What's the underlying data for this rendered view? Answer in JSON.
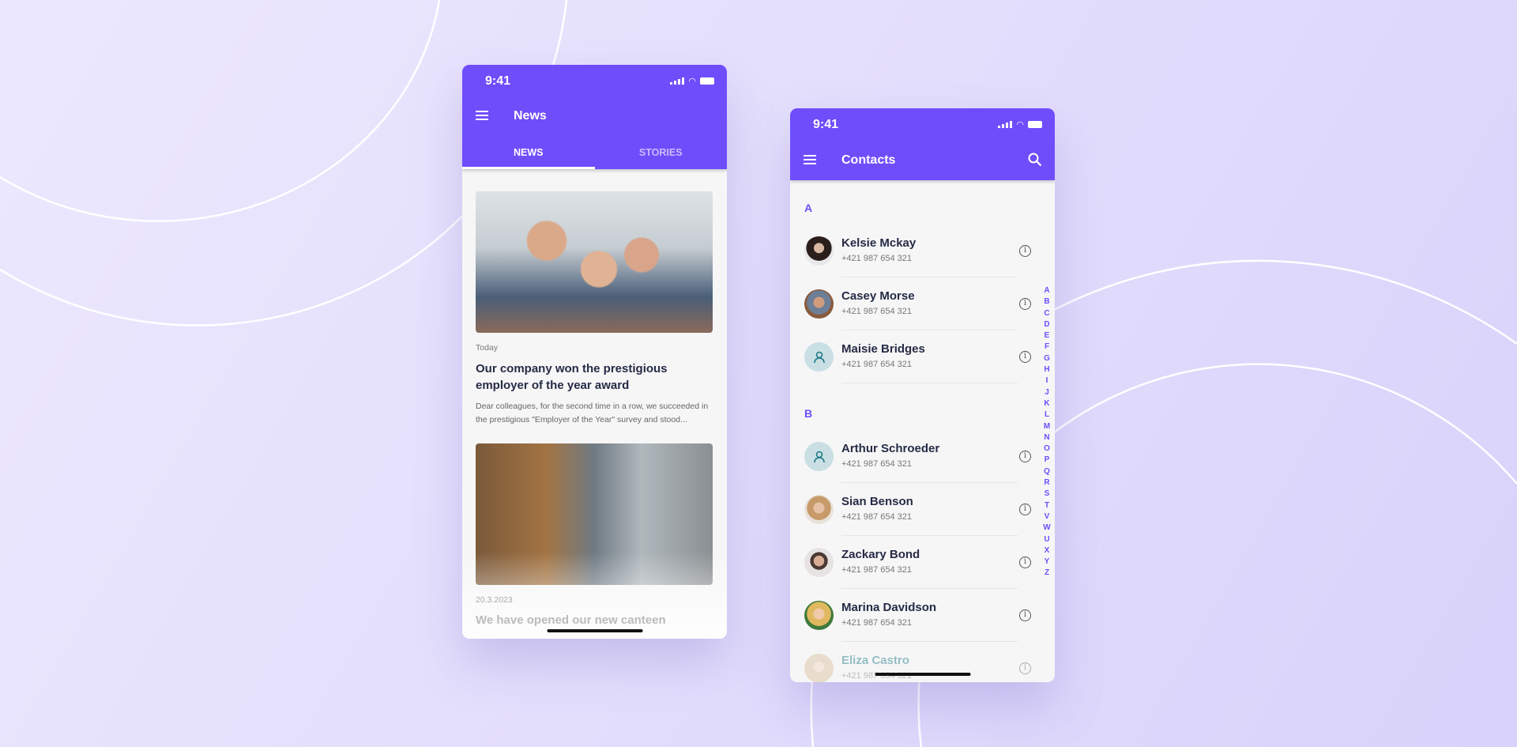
{
  "colors": {
    "accent": "#6f4dfb",
    "background": "#e6e1fc"
  },
  "news_screen": {
    "status": {
      "time": "9:41"
    },
    "header": {
      "title": "News",
      "menu_icon": "hamburger-icon"
    },
    "tabs": [
      {
        "label": "NEWS",
        "active": true
      },
      {
        "label": "STORIES",
        "active": false
      }
    ],
    "articles": [
      {
        "date": "Today",
        "title": "Our company won the prestigious employer of the year award",
        "excerpt": "Dear colleagues, for the second time in a row, we succeeded in the prestigious \"Employer of the Year\" survey and stood..."
      },
      {
        "date": "20.3.2023",
        "title": "We have opened our new canteen"
      }
    ]
  },
  "contacts_screen": {
    "status": {
      "time": "9:41"
    },
    "header": {
      "title": "Contacts",
      "menu_icon": "hamburger-icon",
      "search_icon": "search-icon"
    },
    "sections": [
      {
        "letter": "A",
        "contacts": [
          {
            "name": "Kelsie Mckay",
            "phone": "+421 987 654 321"
          },
          {
            "name": "Casey Morse",
            "phone": "+421 987 654 321"
          },
          {
            "name": "Maisie Bridges",
            "phone": "+421 987 654 321"
          }
        ]
      },
      {
        "letter": "B",
        "contacts": [
          {
            "name": "Arthur Schroeder",
            "phone": "+421 987 654 321"
          },
          {
            "name": "Sian Benson",
            "phone": "+421 987 654 321"
          },
          {
            "name": "Zackary Bond",
            "phone": "+421 987 654 321"
          },
          {
            "name": "Marina Davidson",
            "phone": "+421 987 654 321"
          },
          {
            "name": "Eliza Castro",
            "phone": "+421 987 654 321"
          }
        ]
      }
    ],
    "index": [
      "A",
      "B",
      "C",
      "D",
      "E",
      "F",
      "G",
      "H",
      "I",
      "J",
      "K",
      "L",
      "M",
      "N",
      "O",
      "P",
      "Q",
      "R",
      "S",
      "T",
      "V",
      "W",
      "U",
      "X",
      "Y",
      "Z"
    ]
  }
}
